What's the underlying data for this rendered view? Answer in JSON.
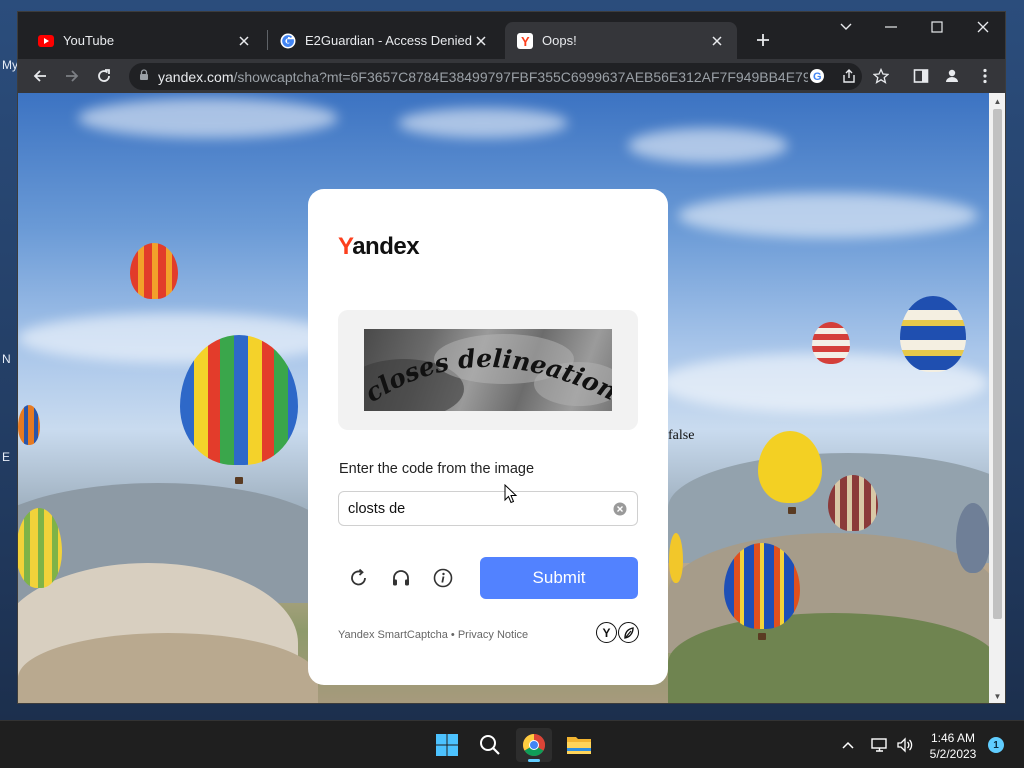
{
  "desktop": {
    "fragments": [
      "My",
      "N",
      "E"
    ]
  },
  "tabs": [
    {
      "label": "YouTube",
      "icon": "youtube-icon"
    },
    {
      "label": "E2Guardian - Access Denied",
      "icon": "google-icon"
    },
    {
      "label": "Oops!",
      "icon": "yandex-icon"
    }
  ],
  "toolbar": {
    "url_domain": "yandex.com",
    "url_rest": "/showcaptcha?mt=6F3657C8784E38499797FBF355C6999637AEB56E312AF7F949BB4E79C..."
  },
  "page": {
    "stray_text": "false",
    "logo_y": "Y",
    "logo_rest": "andex",
    "captcha_text": "closes delineation",
    "prompt": "Enter the code from the image",
    "input_value": "closts de",
    "submit_label": "Submit",
    "footer_brand": "Yandex SmartCaptcha",
    "footer_sep": " • ",
    "footer_link": "Privacy Notice"
  },
  "taskbar": {
    "time": "1:46 AM",
    "date": "5/2/2023",
    "notification_count": "1"
  },
  "colors": {
    "accent": "#5282ff",
    "yandex_red": "#fc3f1d",
    "chrome_dark": "#202124",
    "toolbar": "#35363a"
  }
}
